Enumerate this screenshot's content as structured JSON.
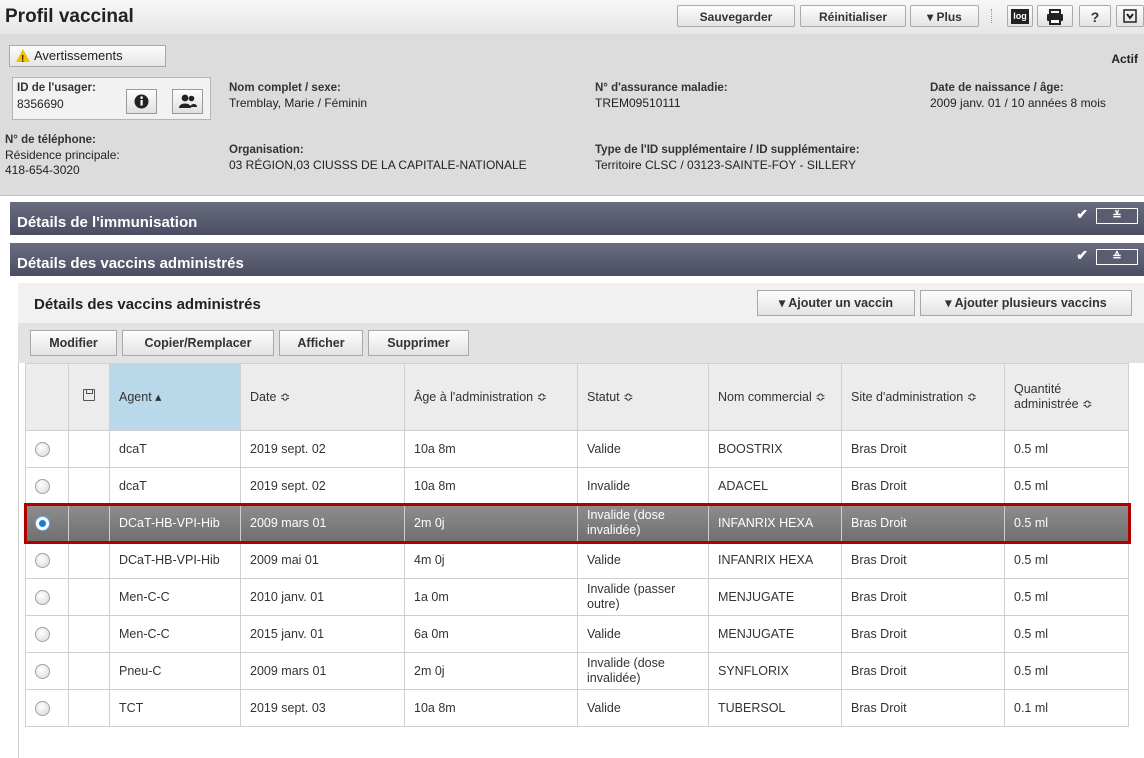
{
  "header": {
    "title": "Profil vaccinal",
    "buttons": {
      "save": "Sauvegarder",
      "reset": "Réinitialiser",
      "more": "▾  Plus",
      "log": "log",
      "help": "?"
    }
  },
  "warnings": {
    "label": "Avertissements",
    "status": "Actif"
  },
  "patient": {
    "id_label": "ID de l'usager:",
    "id_value": "8356690",
    "name_label": "Nom complet / sexe:",
    "name_value": "Tremblay, Marie / Féminin",
    "nam_label": "N° d'assurance maladie:",
    "nam_value": "TREM09510111",
    "dob_label": "Date de naissance / âge:",
    "dob_value": "2009 janv. 01 / 10 années 8 mois",
    "phone_label": "N° de téléphone:",
    "phone_type": "Résidence principale:",
    "phone_value": "418-654-3020",
    "org_label": "Organisation:",
    "org_value": "03 RÉGION,03 CIUSSS DE LA CAPITALE-NATIONALE",
    "extra_label": "Type de l'ID supplémentaire / ID supplémentaire:",
    "extra_value": "Territoire CLSC / 03123-SAINTE-FOY - SILLERY"
  },
  "sections": {
    "immunisation": "Détails de l'immunisation",
    "vaccins": "Détails des vaccins administrés"
  },
  "inner": {
    "title": "Détails des vaccins administrés",
    "add_one": "▾  Ajouter un vaccin",
    "add_many": "▾  Ajouter plusieurs vaccins",
    "actions": {
      "edit": "Modifier",
      "copy": "Copier/Remplacer",
      "show": "Afficher",
      "delete": "Supprimer"
    }
  },
  "table": {
    "headers": {
      "agent": "Agent ▴",
      "date": "Date ≎",
      "age": "Âge à l'administration ≎",
      "status": "Statut ≎",
      "brand": "Nom commercial ≎",
      "site": "Site d'administration ≎",
      "qty": "Quantité administrée ≎"
    },
    "rows": [
      {
        "agent": "dcaT",
        "date": "2019 sept. 02",
        "age": "10a 8m",
        "status": "Valide",
        "brand": "BOOSTRIX",
        "site": "Bras Droit",
        "qty": "0.5 ml"
      },
      {
        "agent": "dcaT",
        "date": "2019 sept. 02",
        "age": "10a 8m",
        "status": "Invalide",
        "brand": "ADACEL",
        "site": "Bras Droit",
        "qty": "0.5 ml"
      },
      {
        "agent": "DCaT-HB-VPI-Hib",
        "date": "2009 mars 01",
        "age": "2m 0j",
        "status": "Invalide (dose invalidée)",
        "brand": "INFANRIX HEXA",
        "site": "Bras Droit",
        "qty": "0.5 ml"
      },
      {
        "agent": "DCaT-HB-VPI-Hib",
        "date": "2009 mai 01",
        "age": "4m 0j",
        "status": "Valide",
        "brand": "INFANRIX HEXA",
        "site": "Bras Droit",
        "qty": "0.5 ml"
      },
      {
        "agent": "Men-C-C",
        "date": "2010 janv. 01",
        "age": "1a 0m",
        "status": "Invalide (passer outre)",
        "brand": "MENJUGATE",
        "site": "Bras Droit",
        "qty": "0.5 ml"
      },
      {
        "agent": "Men-C-C",
        "date": "2015 janv. 01",
        "age": "6a 0m",
        "status": "Valide",
        "brand": "MENJUGATE",
        "site": "Bras Droit",
        "qty": "0.5 ml"
      },
      {
        "agent": "Pneu-C",
        "date": "2009 mars 01",
        "age": "2m 0j",
        "status": "Invalide (dose invalidée)",
        "brand": "SYNFLORIX",
        "site": "Bras Droit",
        "qty": "0.5 ml"
      },
      {
        "agent": "TCT",
        "date": "2019 sept. 03",
        "age": "10a 8m",
        "status": "Valide",
        "brand": "TUBERSOL",
        "site": "Bras Droit",
        "qty": "0.1 ml"
      }
    ]
  }
}
